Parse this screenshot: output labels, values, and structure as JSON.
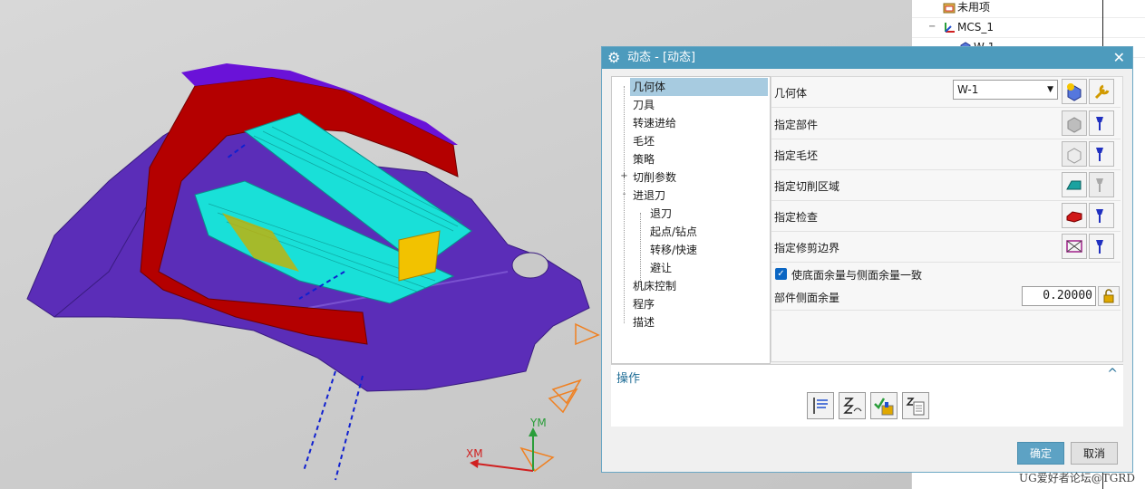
{
  "viewport": {
    "axis_y_label": "YM",
    "axis_x_label": "XM",
    "colors": {
      "part": "#5b2db8",
      "wall": "#b40000",
      "toolpath": "#19e0d8",
      "pocket": "#f2c200",
      "background": "#cccccc"
    }
  },
  "navigator": {
    "items": [
      {
        "label": "未用项",
        "icon": "folder-icon"
      },
      {
        "label": "MCS_1",
        "icon": "coordinate-system-icon"
      },
      {
        "label": "W-1",
        "icon": "workpiece-icon"
      }
    ]
  },
  "dialog": {
    "title": "动态 - [动态]",
    "title_icon": "gear-icon",
    "close_icon": "close-icon",
    "tree": [
      {
        "label": "几何体",
        "selected": true
      },
      {
        "label": "刀具"
      },
      {
        "label": "转速进给"
      },
      {
        "label": "毛坯"
      },
      {
        "label": "策略"
      },
      {
        "label": "切削参数",
        "expander": "+"
      },
      {
        "label": "进退刀",
        "expander": "-"
      },
      {
        "label": "退刀"
      },
      {
        "label": "起点/钻点"
      },
      {
        "label": "转移/快速"
      },
      {
        "label": "避让"
      },
      {
        "label": "机床控制"
      },
      {
        "label": "程序"
      },
      {
        "label": "描述"
      }
    ],
    "geometry": {
      "label": "几何体",
      "value": "W-1",
      "rows": [
        {
          "label": "指定部件"
        },
        {
          "label": "指定毛坯"
        },
        {
          "label": "指定切削区域"
        },
        {
          "label": "指定检查"
        },
        {
          "label": "指定修剪边界"
        }
      ],
      "checkbox_label": "使底面余量与侧面余量一致",
      "checkbox_checked": true,
      "stock_label": "部件侧面余量",
      "stock_value": "0.20000"
    },
    "operations": {
      "header": "操作",
      "buttons": [
        "generate-icon",
        "replay-icon",
        "verify-icon",
        "list-icon"
      ]
    },
    "ok_label": "确定",
    "cancel_label": "取消"
  },
  "watermark": "UG爱好者论坛@TGRD"
}
